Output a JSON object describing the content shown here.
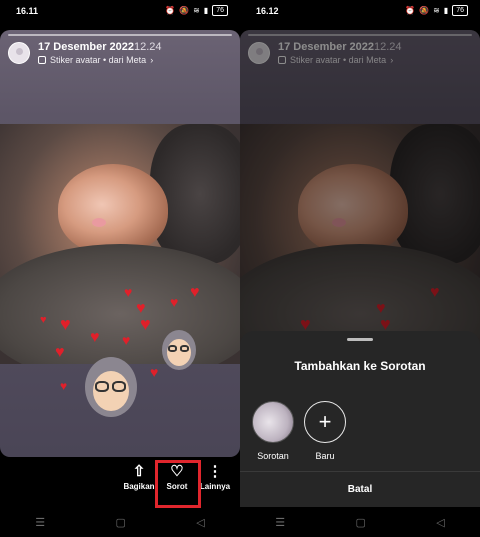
{
  "left": {
    "status": {
      "time": "16.11",
      "battery": "76"
    },
    "story": {
      "date": "17 Desember 2022",
      "time": "12.24",
      "subtitle": "Stiker avatar • dari Meta",
      "chevron": "›"
    },
    "actions": {
      "share_label": "Bagikan",
      "highlight_label": "Sorot",
      "more_label": "Lainnya",
      "share_icon": "share-icon",
      "highlight_icon": "heart-circle-icon",
      "more_icon": "more-vertical-icon"
    }
  },
  "right": {
    "status": {
      "time": "16.12",
      "battery": "76"
    },
    "story": {
      "date": "17 Desember 2022",
      "time": "12.24",
      "subtitle": "Stiker avatar • dari Meta",
      "chevron": "›"
    },
    "sheet": {
      "title": "Tambahkan ke Sorotan",
      "existing_label": "Sorotan",
      "new_label": "Baru",
      "new_symbol": "+",
      "cancel_label": "Batal"
    }
  },
  "nav": {
    "menu_symbol": "☰",
    "home_symbol": "▢",
    "back_symbol": "◁"
  },
  "colors": {
    "highlight_border": "#e0262d",
    "sheet_bg": "#262626"
  }
}
